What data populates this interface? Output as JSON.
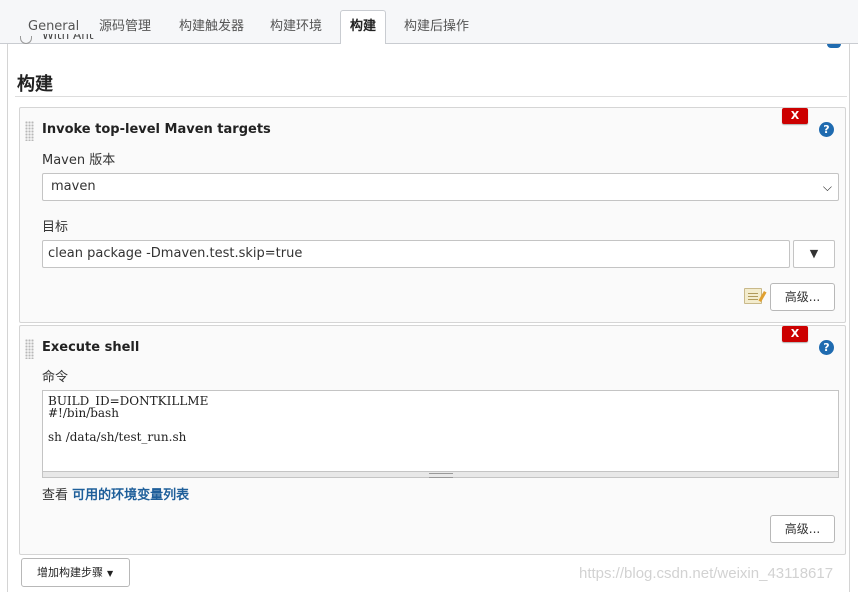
{
  "tabs": [
    {
      "label": "General"
    },
    {
      "label": "源码管理"
    },
    {
      "label": "构建触发器"
    },
    {
      "label": "构建环境"
    },
    {
      "label": "构建"
    },
    {
      "label": "构建后操作"
    }
  ],
  "active_tab": "构建",
  "cut_off_text": "With Ant",
  "section_title": "构建",
  "maven_step": {
    "title": "Invoke top-level Maven targets",
    "delete_label": "X",
    "help_label": "?",
    "maven_version_label": "Maven 版本",
    "maven_version_value": "maven",
    "goals_label": "目标",
    "goals_value": "clean package -Dmaven.test.skip=true",
    "dropdown_glyph": "▼",
    "advanced_label": "高级..."
  },
  "shell_step": {
    "title": "Execute shell",
    "delete_label": "X",
    "help_label": "?",
    "command_label": "命令",
    "command_value": "BUILD_ID=DONTKILLME\n#!/bin/bash\n\nsh /data/sh/test_run.sh",
    "env_prefix": "查看",
    "env_link": "可用的环境变量列表",
    "advanced_label": "高级..."
  },
  "add_step_label": "增加构建步骤",
  "watermark": "https://blog.csdn.net/weixin_43118617",
  "colors": {
    "delete_red": "#cc0000",
    "help_blue": "#1f6bb0",
    "link_blue": "#1f5f9a"
  }
}
